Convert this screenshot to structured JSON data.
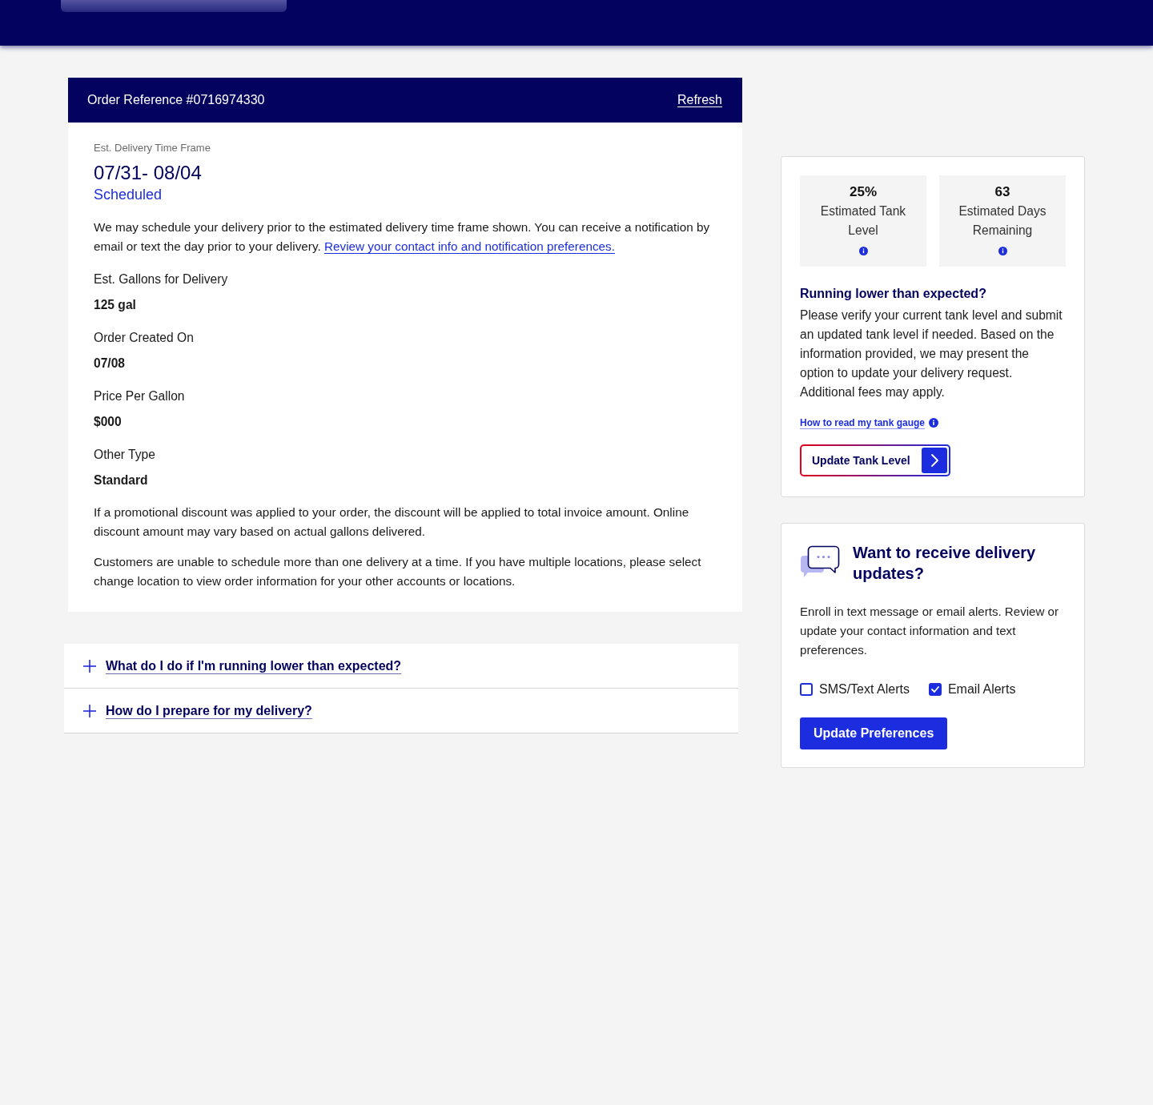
{
  "order": {
    "reference": "Order Reference #0716974330",
    "refresh": "Refresh",
    "timeframe_label": "Est. Delivery Time Frame",
    "timeframe": "07/31- 08/04",
    "status": "Scheduled",
    "notice": "We may schedule your delivery prior to the estimated delivery time frame shown. You can receive a notification by email or text the day prior to your delivery.",
    "notice_link": "Review your contact info and notification preferences.",
    "details": [
      {
        "label": "Est. Gallons for Delivery",
        "value": "125 gal"
      },
      {
        "label": "Order Created On",
        "value": "07/08"
      },
      {
        "label": "Price Per Gallon",
        "value": "$000"
      },
      {
        "label": "Other Type",
        "value": "Standard"
      }
    ],
    "notes": [
      "If a promotional discount was applied to your order, the discount will be applied to total invoice amount. Online discount amount may vary based on actual gallons delivered.",
      "Customers are unable to schedule more than one delivery at a time. If you have multiple locations, please select change location to view order information for your other accounts or locations."
    ]
  },
  "faq": [
    {
      "question": "What do I do if I'm running lower than expected?",
      "expanded": false
    },
    {
      "question": "How do I prepare for my delivery?",
      "expanded": false
    }
  ],
  "tank": {
    "stats": [
      {
        "value": "25%",
        "label": "Estimated Tank Level"
      },
      {
        "value": "63",
        "label": "Estimated Days Remaining"
      }
    ],
    "heading": "Running lower than expected?",
    "body": "Please verify your current tank level and submit an updated tank level if needed. Based on the information provided, we may present the option to update your delivery request. Additional fees may apply.",
    "gauge_link": "How to read my tank gauge",
    "button": "Update Tank Level"
  },
  "alerts": {
    "heading": "Want to receive delivery updates?",
    "body": "Enroll in text message or email alerts. Review or update your contact information and text preferences.",
    "options": [
      {
        "label": "SMS/Text Alerts",
        "checked": false
      },
      {
        "label": "Email Alerts",
        "checked": true
      }
    ],
    "button": "Update Preferences"
  }
}
